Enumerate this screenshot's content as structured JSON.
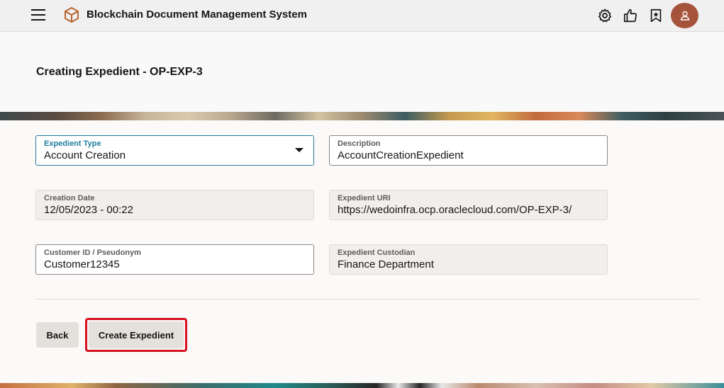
{
  "header": {
    "app_title": "Blockchain Document Management System",
    "icons": [
      "menu-icon",
      "cube-logo-icon",
      "gear-icon",
      "thumbs-up-icon",
      "bookmark-icon",
      "user-avatar"
    ],
    "avatar_color": "#a6533b"
  },
  "page": {
    "title": "Creating Expedient - OP-EXP-3"
  },
  "form": {
    "expedient_type": {
      "label": "Expedient Type",
      "value": "Account Creation"
    },
    "description": {
      "label": "Description",
      "value": "AccountCreationExpedient"
    },
    "creation_date": {
      "label": "Creation Date",
      "value": "12/05/2023 - 00:22"
    },
    "expedient_uri": {
      "label": "Expedient URI",
      "value": "https://wedoinfra.ocp.oraclecloud.com/OP-EXP-3/"
    },
    "customer_id": {
      "label": "Customer ID / Pseudonym",
      "value": "Customer12345"
    },
    "expedient_custodian": {
      "label": "Expedient Custodian",
      "value": "Finance Department"
    }
  },
  "actions": {
    "back_label": "Back",
    "create_label": "Create Expedient",
    "highlight_color": "#d9101e"
  }
}
